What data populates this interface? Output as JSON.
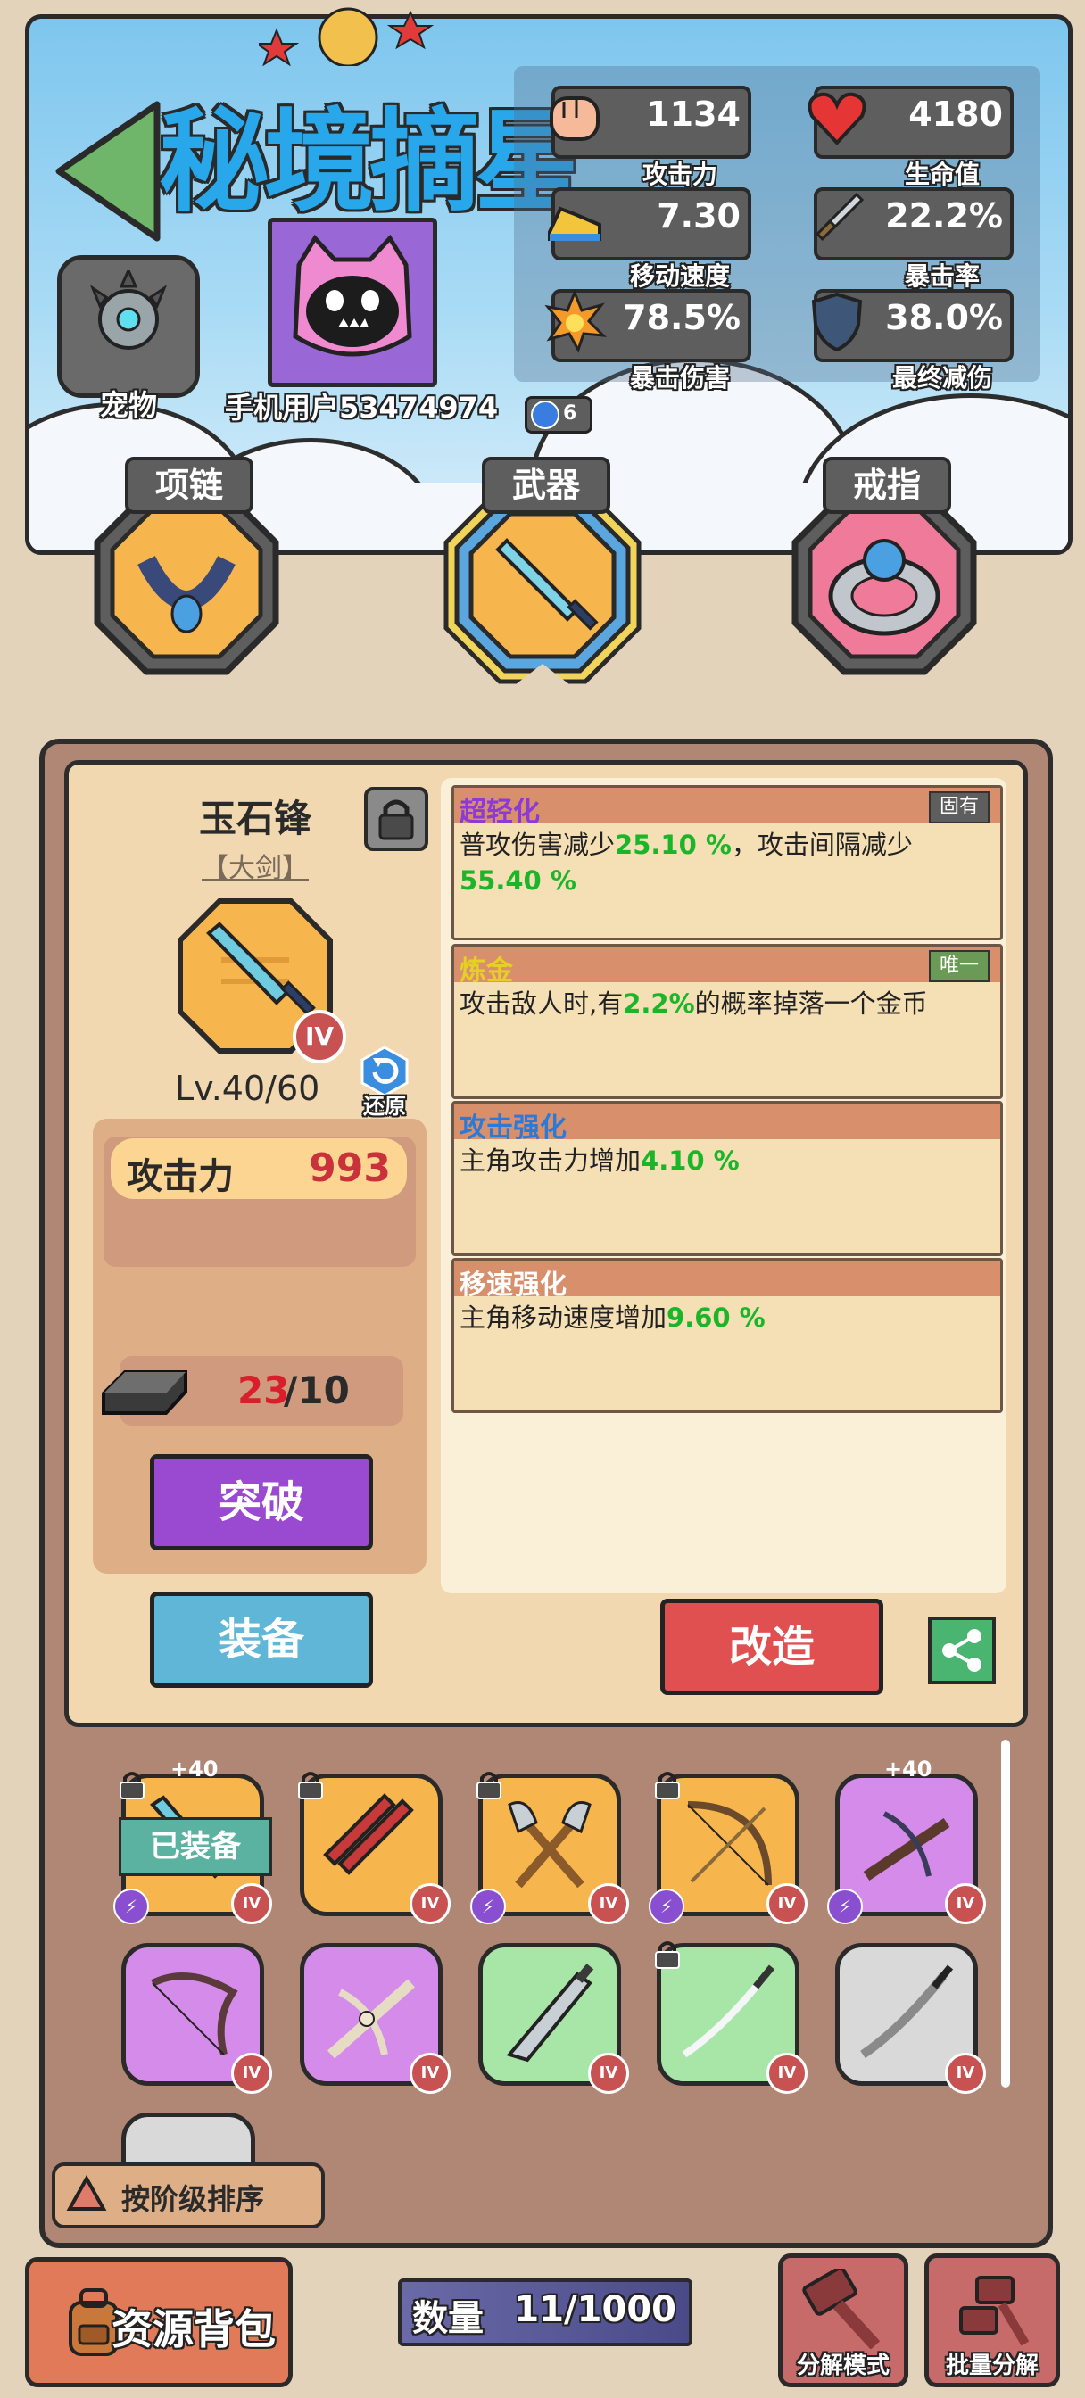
{
  "header": {
    "title": "秘境摘星",
    "pet_label": "宠物",
    "username": "手机用户53474974",
    "drop_count": "6"
  },
  "stats": [
    {
      "value": "1134",
      "label": "攻击力",
      "icon": "fist-icon"
    },
    {
      "value": "4180",
      "label": "生命值",
      "icon": "heart-icon"
    },
    {
      "value": "7.30",
      "label": "移动速度",
      "icon": "sneaker-icon"
    },
    {
      "value": "22.2%",
      "label": "暴击率",
      "icon": "dagger-icon"
    },
    {
      "value": "78.5%",
      "label": "暴击伤害",
      "icon": "explosion-icon"
    },
    {
      "value": "38.0%",
      "label": "最终减伤",
      "icon": "shield-icon"
    }
  ],
  "slots": {
    "necklace": "项链",
    "weapon": "武器",
    "ring": "戒指"
  },
  "item": {
    "name": "玉石锋",
    "type": "【大剑】",
    "grade": "IV",
    "level": "Lv.40/60",
    "restore": "还原",
    "attack_label": "攻击力",
    "attack_value": "993",
    "material_have": "23",
    "material_need": "/10",
    "breakthrough": "突破",
    "equip": "装备",
    "reforge": "改造"
  },
  "affixes": [
    {
      "name": "超轻化",
      "tag": "固有",
      "text_a": "普攻伤害减少",
      "val_a": "25.10 %",
      "text_b": "，攻击间隔减少",
      "val_b": "55.40 %"
    },
    {
      "name": "炼金",
      "tag": "唯一",
      "text_a": "攻击敌人时,有",
      "val_a": "2.2%",
      "text_b": "的概率掉落一个金币"
    },
    {
      "name": "攻击强化",
      "text_a": "主角攻击力增加",
      "val_a": "4.10 %"
    },
    {
      "name": "移速强化",
      "text_a": "主角移动速度增加",
      "val_a": "9.60 %"
    }
  ],
  "inventory": {
    "equipped_label": "已装备",
    "plus_label": "+40",
    "grade": "IV",
    "items": [
      {
        "color": "orange",
        "weapon": "sword-icon",
        "equipped": true,
        "plus": true,
        "lock": true,
        "bolt": true
      },
      {
        "color": "orange",
        "weapon": "twin-blades-icon",
        "lock": true
      },
      {
        "color": "orange",
        "weapon": "double-axe-icon",
        "lock": true,
        "bolt": true
      },
      {
        "color": "orange",
        "weapon": "bow-icon",
        "lock": true,
        "bolt": true
      },
      {
        "color": "purple",
        "weapon": "crossbow-icon",
        "plus": true,
        "bolt": true
      },
      {
        "color": "purple",
        "weapon": "recurve-bow-icon"
      },
      {
        "color": "purple",
        "weapon": "bone-crossbow-icon"
      },
      {
        "color": "green",
        "weapon": "machete-icon"
      },
      {
        "color": "green",
        "weapon": "katana-icon",
        "lock": true
      },
      {
        "color": "gray",
        "weapon": "katana-icon"
      }
    ]
  },
  "sort_label": "按阶级排序",
  "footer": {
    "backpack": "资源背包",
    "quantity_label": "数量",
    "quantity_value": "11/1000",
    "dismantle_mode": "分解模式",
    "batch_dismantle": "批量分解"
  },
  "colors": {
    "orange_tile": "#f7b54d",
    "purple_tile": "#d48bea",
    "green_tile": "#a8e6a8",
    "gray_tile": "#d9d9d9",
    "breakthrough": "#9a4ad0",
    "equip": "#5fb6d6",
    "reforge": "#e05050"
  }
}
